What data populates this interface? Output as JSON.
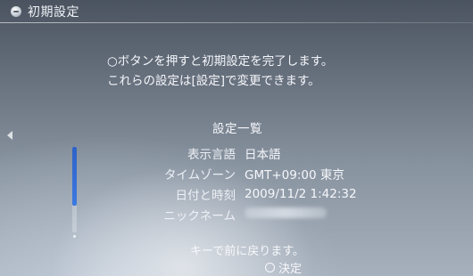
{
  "header": {
    "title": "初期設定"
  },
  "instruction": {
    "line1": "○ボタンを押すと初期設定を完了します。",
    "line2": "これらの設定は[設定]で変更できます。"
  },
  "summary": {
    "title": "設定一覧",
    "rows": [
      {
        "label": "表示言語",
        "value": "日本語"
      },
      {
        "label": "タイムゾーン",
        "value": "GMT+09:00 東京"
      },
      {
        "label": "日付と時刻",
        "value": "2009/11/2 1:42:32"
      },
      {
        "label": "ニックネーム",
        "value": ""
      }
    ]
  },
  "footer": {
    "back_text": "キーで前に戻ります。",
    "confirm_text": "決定"
  },
  "scroll": {
    "position_fraction": 0.69
  },
  "colors": {
    "scroll_thumb": "#2e62c8"
  }
}
